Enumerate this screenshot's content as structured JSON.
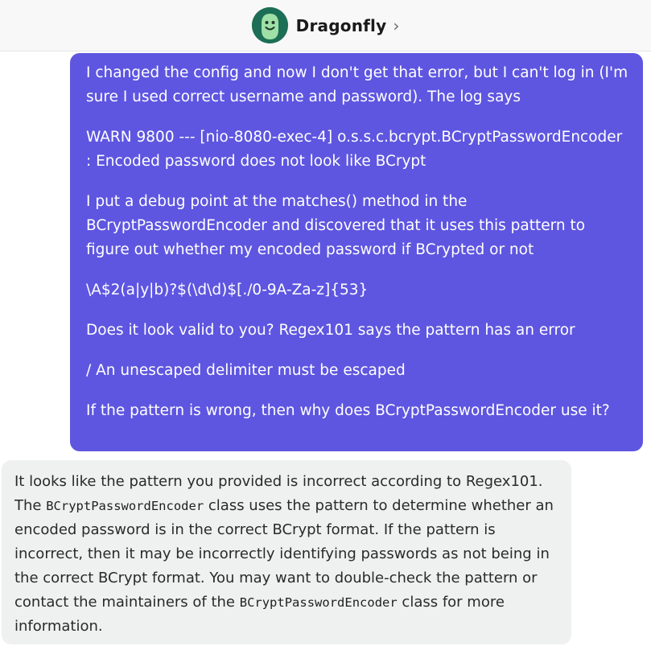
{
  "header": {
    "bot_name": "Dragonfly",
    "chevron": "›",
    "avatar_icon": "dragonfly-avatar-icon",
    "avatar_color": "#1c6e55"
  },
  "colors": {
    "user_bubble": "#5e56e0",
    "bot_bubble": "#eff0f0"
  },
  "user_message": {
    "paragraphs": [
      "I changed the config and now I don't get that error, but I can't log in (I'm sure I used correct username and password). The log says",
      "WARN 9800 --- [nio-8080-exec-4] o.s.s.c.bcrypt.BCryptPasswordEncoder : Encoded password does not look like BCrypt",
      "I put a debug point at the matches() method in the BCryptPasswordEncoder and discovered that it uses this pattern to figure out whether my encoded password if BCrypted or not",
      "\\A$2(a|y|b)?$(\\d\\d)$[./0-9A-Za-z]{53}",
      "Does it look valid to you? Regex101 says the pattern has an error",
      "/ An unescaped delimiter must be escaped",
      "If the pattern is wrong, then why does BCryptPasswordEncoder use it?"
    ]
  },
  "bot_message": {
    "t1": "It looks like the pattern you provided is incorrect according to Regex101. The ",
    "code1": "BCryptPasswordEncoder",
    "t2": " class uses the pattern to determine whether an encoded password is in the correct BCrypt format. If the pattern is incorrect, then it may be incorrectly identifying passwords as not being in the correct BCrypt format. You may want to double-check the pattern or contact the maintainers of the ",
    "code2": "BCryptPasswordEncoder",
    "t3": " class for more information."
  }
}
